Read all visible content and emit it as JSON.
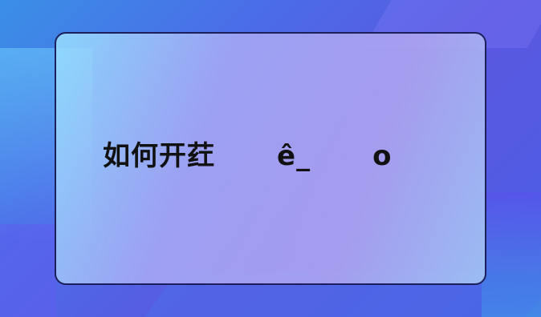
{
  "card": {
    "title": "如何开荭      ê_      o"
  }
}
